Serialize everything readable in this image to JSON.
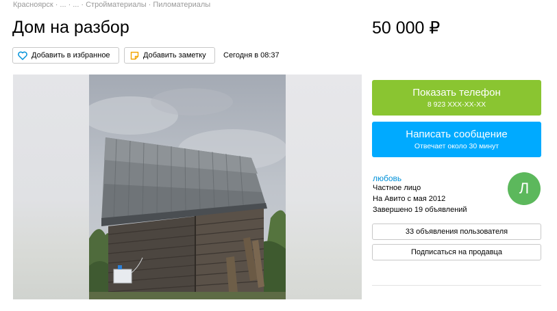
{
  "breadcrumb": {
    "items": [
      "Красноярск",
      "...",
      "...",
      "Стройматериалы",
      "Пиломатериалы"
    ],
    "separator": "·"
  },
  "listing": {
    "title": "Дом на разбор",
    "price": "50 000 ₽",
    "date": "Сегодня в 08:37"
  },
  "actions": {
    "favorite_label": "Добавить в избранное",
    "note_label": "Добавить заметку"
  },
  "contact": {
    "phone_label": "Показать телефон",
    "phone_number": "8 923 XXX-XX-XX",
    "message_label": "Написать сообщение",
    "message_sub": "Отвечает около 30 минут"
  },
  "seller": {
    "name": "любовь",
    "type": "Частное лицо",
    "since": "На Авито с мая 2012",
    "completed": "Завершено 19 объявлений",
    "avatar_letter": "Л",
    "listings_button": "33 объявления пользователя",
    "subscribe_button": "Подписаться на продавца"
  },
  "colors": {
    "phone_button": "#8ac531",
    "message_button": "#00aaff",
    "seller_link": "#0091d9",
    "avatar": "#5cb85c"
  },
  "icons": {
    "favorite": "heart-icon",
    "note": "note-icon"
  }
}
